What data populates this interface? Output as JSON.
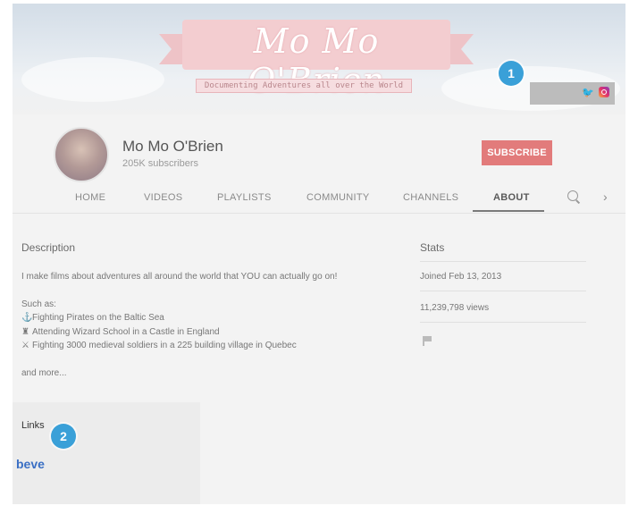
{
  "banner": {
    "title": "Mo Mo O'Brien",
    "subtitle": "Documenting Adventures all over the World"
  },
  "markers": {
    "one": "1",
    "two": "2"
  },
  "channel": {
    "name": "Mo Mo O'Brien",
    "subscribers": "205K subscribers",
    "subscribe_label": "SUBSCRIBE"
  },
  "tabs": [
    {
      "label": "HOME"
    },
    {
      "label": "VIDEOS"
    },
    {
      "label": "PLAYLISTS"
    },
    {
      "label": "COMMUNITY"
    },
    {
      "label": "CHANNELS"
    },
    {
      "label": "ABOUT",
      "active": true
    }
  ],
  "description": {
    "title": "Description",
    "intro": "I make films about adventures all around the world that YOU can actually go on!",
    "such_as": "Such as:",
    "items": [
      {
        "icon": "pirate-ship-icon",
        "glyph": "⚓",
        "text": "Fighting Pirates on the Baltic Sea"
      },
      {
        "icon": "castle-icon",
        "glyph": "♜",
        "text": "Attending Wizard School in a Castle in England"
      },
      {
        "icon": "swords-icon",
        "glyph": "⚔",
        "text": "Fighting 3000 medieval soldiers in a 225 building village in Quebec"
      }
    ],
    "more": "and more..."
  },
  "stats": {
    "title": "Stats",
    "joined": "Joined Feb 13, 2013",
    "views": "11,239,798 views"
  },
  "links": {
    "title": "Links",
    "caption": "beve"
  },
  "colors": {
    "subscribe": "#e27b7b",
    "marker": "#3aa0d8",
    "twitter": "#1da1f2",
    "caption": "#3a6fc4"
  }
}
